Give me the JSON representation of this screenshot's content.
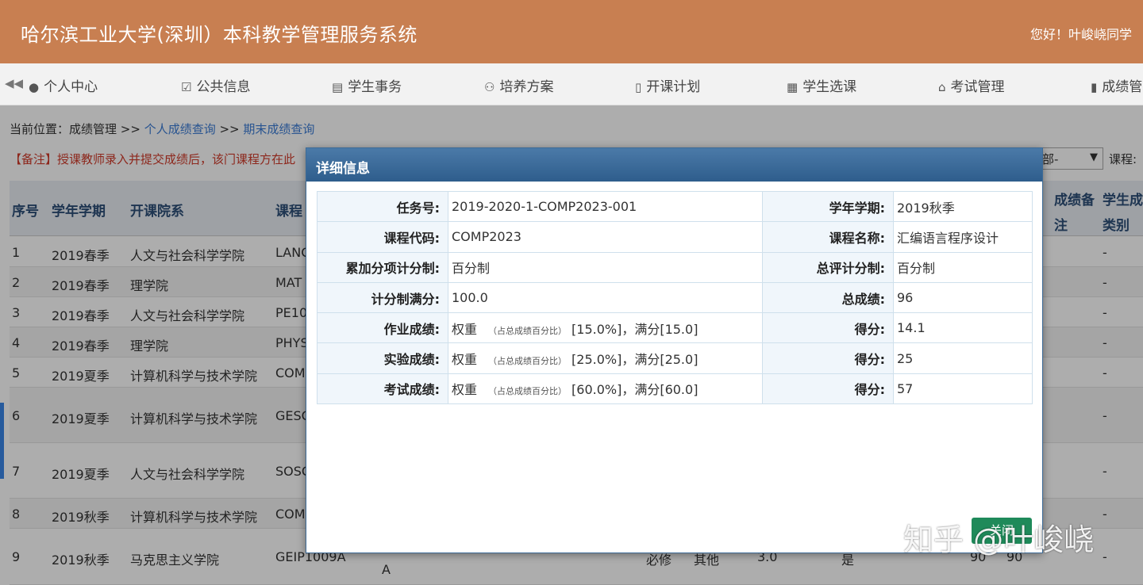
{
  "header": {
    "title": "哈尔滨工业大学(深圳）本科教学管理服务系统",
    "greeting": "您好！叶峻峣同学"
  },
  "nav": {
    "back_icon": "double-chevron-left",
    "items": [
      {
        "label": "个人中心",
        "icon": "user-icon"
      },
      {
        "label": "公共信息",
        "icon": "check-square-icon"
      },
      {
        "label": "学生事务",
        "icon": "newspaper-icon"
      },
      {
        "label": "培养方案",
        "icon": "users-icon"
      },
      {
        "label": "开课计划",
        "icon": "file-icon"
      },
      {
        "label": "学生选课",
        "icon": "calendar-icon"
      },
      {
        "label": "考试管理",
        "icon": "inbox-icon"
      },
      {
        "label": "成绩管",
        "icon": "file-text-icon"
      }
    ]
  },
  "breadcrumb": {
    "prefix": "当前位置：成绩管理 >> ",
    "link1": "个人成绩查询",
    "sep": " >> ",
    "link2": "期末成绩查询"
  },
  "note": "【备注】授课教师录入并提交成绩后，该门课程方在此",
  "filter": {
    "select_value": "部-",
    "course_label": "课程:"
  },
  "table": {
    "headers": [
      "序号",
      "学年学期",
      "开课院系",
      "课程",
      "成绩备注",
      "学生成绩类别"
    ],
    "header_extra": {
      "col_a_top": "成绩备",
      "col_a_bot": "注",
      "col_b_top": "学生成",
      "col_b_bot": "类别"
    },
    "rows": [
      {
        "no": "1",
        "term": "2019春季",
        "dept": "人文与社会科学学院",
        "code": "LANC",
        "tail": "-"
      },
      {
        "no": "2",
        "term": "2019春季",
        "dept": "理学院",
        "code": "MAT",
        "tail": "-"
      },
      {
        "no": "3",
        "term": "2019春季",
        "dept": "人文与社会科学学院",
        "code": "PE10",
        "tail": "-"
      },
      {
        "no": "4",
        "term": "2019春季",
        "dept": "理学院",
        "code": "PHYS",
        "tail": "-"
      },
      {
        "no": "5",
        "term": "2019夏季",
        "dept": "计算机科学与技术学院",
        "code": "COM",
        "tail": "-"
      },
      {
        "no": "6",
        "term": "2019夏季",
        "dept": "计算机科学与技术学院",
        "code": "GESC",
        "tail": "-"
      },
      {
        "no": "7",
        "term": "2019夏季",
        "dept": "人文与社会科学学院",
        "code": "SOSC",
        "tail": "-"
      },
      {
        "no": "8",
        "term": "2019秋季",
        "dept": "计算机科学与技术学院",
        "code": "COM",
        "tail": "-"
      },
      {
        "no": "9",
        "term": "2019秋季",
        "dept": "马克思主义学院",
        "code": "GEIP1009A",
        "tail": "-"
      }
    ],
    "row9_extra": {
      "a": "A",
      "req": "必修",
      "other": "其他",
      "credit": "3.0",
      "yes": "是",
      "s1": "90",
      "s2": "90"
    }
  },
  "dialog": {
    "title": "详细信息",
    "rows": [
      {
        "k1": "任务号:",
        "v1": "2019-2020-1-COMP2023-001",
        "k2": "学年学期:",
        "v2": "2019秋季"
      },
      {
        "k1": "课程代码:",
        "v1": "COMP2023",
        "k2": "课程名称:",
        "v2": "汇编语言程序设计"
      },
      {
        "k1": "累加分项计分制:",
        "v1": "百分制",
        "k2": "总评计分制:",
        "v2": "百分制"
      },
      {
        "k1": "计分制满分:",
        "v1": "100.0",
        "k2": "总成绩:",
        "v2": "96"
      },
      {
        "k1": "作业成绩:",
        "w": "权重",
        "note": "（占总成绩百分比）",
        "detail": "[15.0%]，满分[15.0]",
        "k2": "得分:",
        "v2": "14.1"
      },
      {
        "k1": "实验成绩:",
        "w": "权重",
        "note": "（占总成绩百分比）",
        "detail": "[25.0%]，满分[25.0]",
        "k2": "得分:",
        "v2": "25"
      },
      {
        "k1": "考试成绩:",
        "w": "权重",
        "note": "（占总成绩百分比）",
        "detail": "[60.0%]，满分[60.0]",
        "k2": "得分:",
        "v2": "57"
      }
    ],
    "close_label": "关闭"
  },
  "watermark": "知乎 @叶峻峣"
}
